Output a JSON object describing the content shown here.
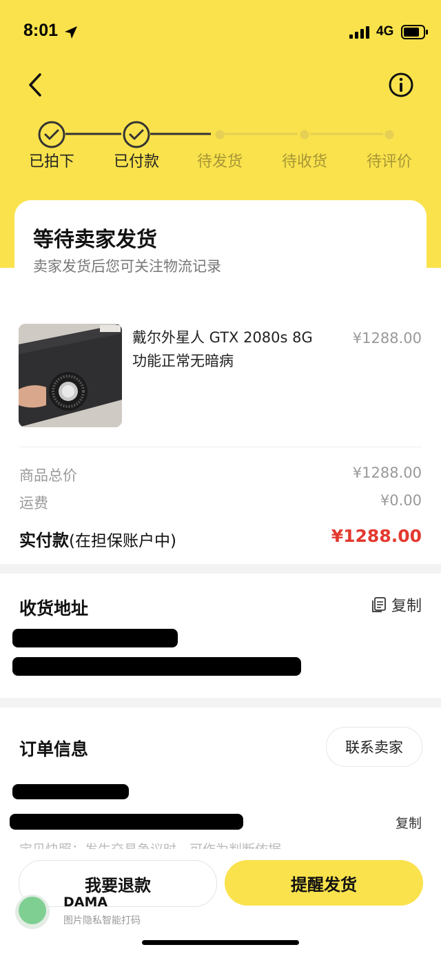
{
  "status_bar": {
    "time": "8:01",
    "network": "4G"
  },
  "steps": [
    {
      "label": "已拍下",
      "state": "done"
    },
    {
      "label": "已付款",
      "state": "done"
    },
    {
      "label": "待发货",
      "state": "todo"
    },
    {
      "label": "待收货",
      "state": "todo"
    },
    {
      "label": "待评价",
      "state": "todo"
    }
  ],
  "status_card": {
    "title": "等待卖家发货",
    "subtitle": "卖家发货后您可关注物流记录"
  },
  "product": {
    "name": "戴尔外星人 GTX 2080s 8G 功能正常无暗病",
    "price": "¥1288.00"
  },
  "summary": {
    "goods_total_label": "商品总价",
    "goods_total": "¥1288.00",
    "shipping_label": "运费",
    "shipping": "¥0.00",
    "paid_label": "实付款",
    "paid_note": "(在担保账户中)",
    "paid": "¥1288.00"
  },
  "address": {
    "title": "收货地址",
    "copy_label": "复制"
  },
  "order_info": {
    "title": "订单信息",
    "contact_label": "联系卖家",
    "copy_label": "复制",
    "snapshot_text": "宝贝快照：发生交易争议时，可作为判断依据"
  },
  "actions": {
    "refund_label": "我要退款",
    "remind_label": "提醒发货"
  },
  "watermark": {
    "brand": "DAMA",
    "subtitle": "图片隐私智能打码"
  },
  "colors": {
    "accent_yellow": "#f9e24c",
    "price_red": "#e3392f"
  }
}
